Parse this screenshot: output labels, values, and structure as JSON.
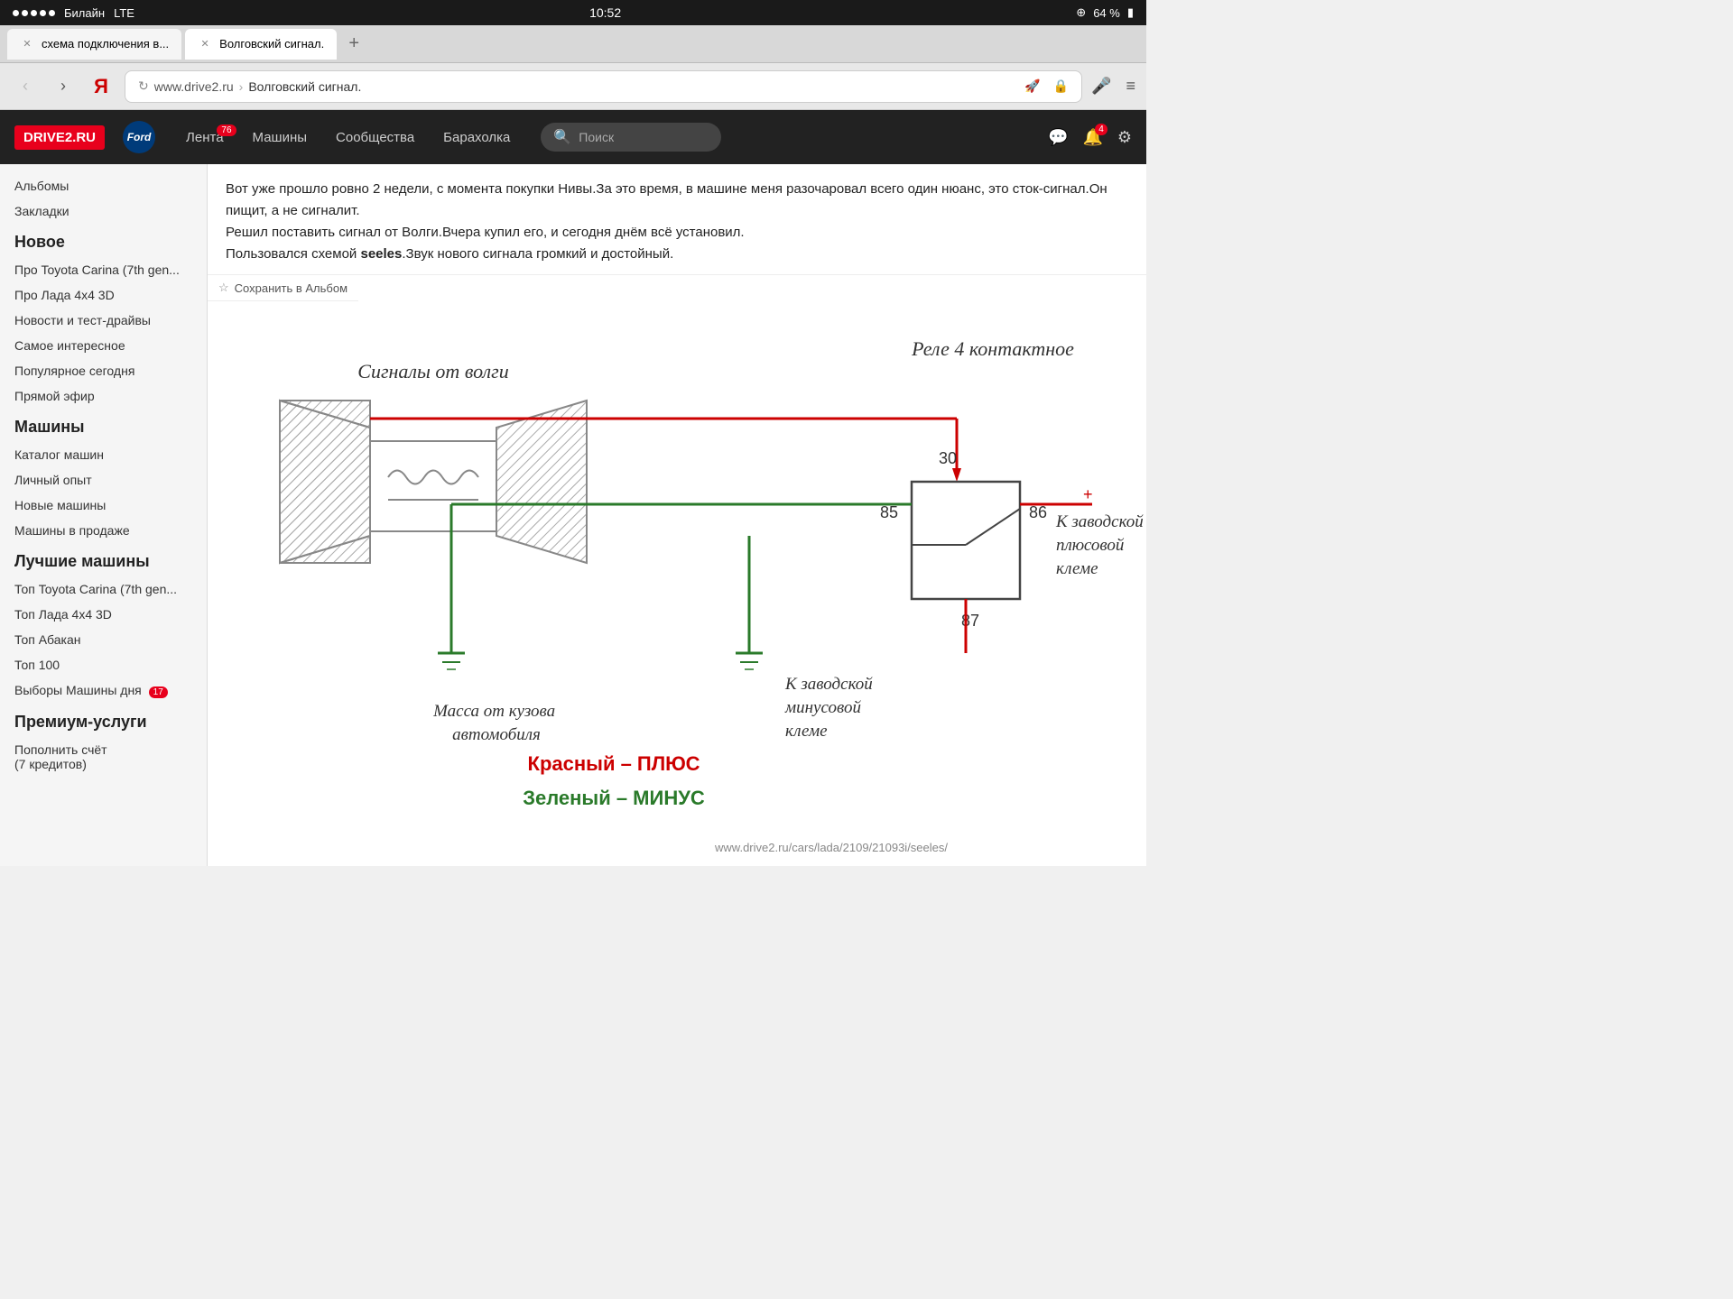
{
  "statusBar": {
    "carrier": "Билайн",
    "network": "LTE",
    "time": "10:52",
    "battery": "64 %",
    "dots": 5
  },
  "tabs": [
    {
      "id": "tab1",
      "label": "схема подключения в...",
      "active": false
    },
    {
      "id": "tab2",
      "label": "Волговский сигнал.",
      "active": true
    }
  ],
  "tabAdd": "+",
  "addressBar": {
    "domain": "www.drive2.ru",
    "separator": "›",
    "path": "Волговский сигнал."
  },
  "topNav": {
    "logo": "DRIVE2.RU",
    "fordLogo": "Ford",
    "items": [
      {
        "label": "Лента",
        "badge": "76"
      },
      {
        "label": "Машины",
        "badge": null
      },
      {
        "label": "Сообщества",
        "badge": null
      },
      {
        "label": "Барахолка",
        "badge": null
      }
    ],
    "search": {
      "placeholder": "Поиск"
    },
    "notifBadge": "4"
  },
  "sidebar": {
    "items1": [
      {
        "label": "Альбомы"
      },
      {
        "label": "Закладки"
      }
    ],
    "section1": "Новое",
    "items2": [
      {
        "label": "Про Toyota Carina (7th gen..."
      },
      {
        "label": "Про Лада 4x4 3D"
      },
      {
        "label": "Новости и тест-драйвы"
      },
      {
        "label": "Самое интересное"
      },
      {
        "label": "Популярное сегодня"
      },
      {
        "label": "Прямой эфир"
      }
    ],
    "section2": "Машины",
    "items3": [
      {
        "label": "Каталог машин"
      },
      {
        "label": "Личный опыт"
      },
      {
        "label": "Новые машины"
      },
      {
        "label": "Машины в продаже"
      }
    ],
    "section3": "Лучшие машины",
    "items4": [
      {
        "label": "Топ Toyota Carina (7th gen..."
      },
      {
        "label": "Топ Лада 4x4 3D"
      },
      {
        "label": "Топ Абакан"
      },
      {
        "label": "Топ 100"
      },
      {
        "label": "Выборы Машины дня",
        "badge": "17"
      }
    ],
    "section4": "Премиум-услуги",
    "items5": [
      {
        "label": "Пополнить счёт\n(7 кредитов)"
      }
    ]
  },
  "article": {
    "text1": "Вот уже прошло ровно 2 недели, с момента покупки Нивы.За это время, в машине меня разочаровал всего один нюанс, это сток-сигнал.Он пищит, а не сигналит.",
    "text2": "Решил поставить сигнал от Волги.Вчера купил его, и сегодня днём всё установил.",
    "text3": "Пользовался схемой ",
    "boldText": "seeles",
    "text4": ".Звук нового сигнала громкий и достойный."
  },
  "saveAlbum": "Сохранить в Альбом",
  "diagram": {
    "title1": "Сигналы от волги",
    "title2": "Реле 4 контактное",
    "label30": "30",
    "label85": "85",
    "label86": "86",
    "label87": "87",
    "labelMass": "Масса от кузова автомобиля",
    "labelZavod1": "К заводской плюсовой клеме",
    "labelZavod2": "К заводской минусовой клеме",
    "labelRed": "Красный – ПЛЮС",
    "labelGreen": "Зеленый – МИНУС",
    "watermark": "www.drive2.ru/cars/lada/2109/21093i/seeles/"
  }
}
